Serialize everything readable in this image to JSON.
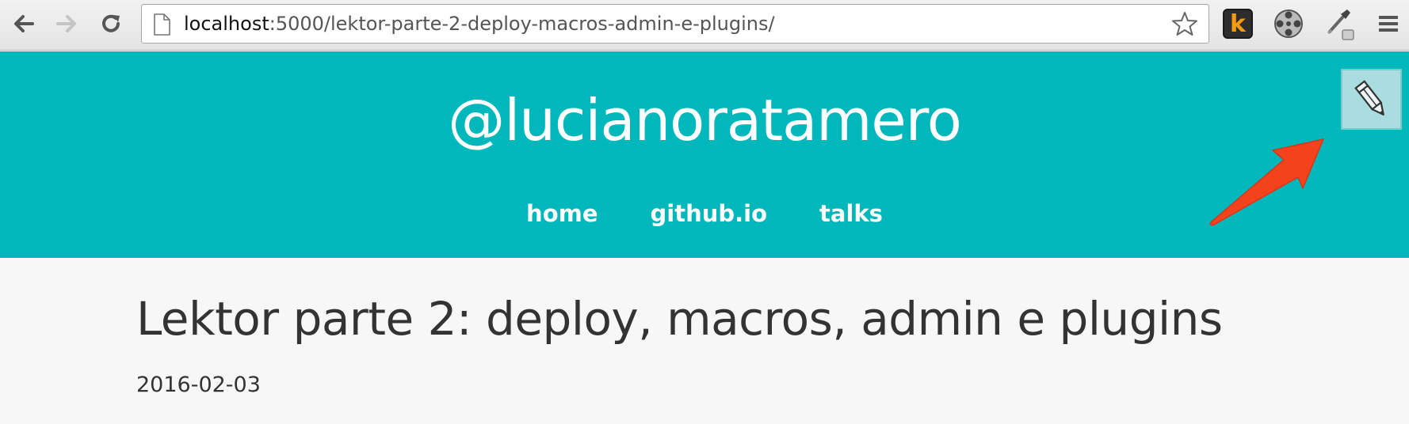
{
  "browser": {
    "url_host": "localhost",
    "url_path": ":5000/lektor-parte-2-deploy-macros-admin-e-plugins/",
    "extension_k_label": "k",
    "icons": [
      "back-icon",
      "forward-icon",
      "reload-icon",
      "page-icon",
      "star-icon",
      "film-reel-icon",
      "eyedropper-icon",
      "menu-icon"
    ]
  },
  "header": {
    "site_title": "@lucianoratamero",
    "nav": [
      {
        "label": "home"
      },
      {
        "label": "github.io"
      },
      {
        "label": "talks"
      }
    ],
    "bg_color": "#00b8bb",
    "edit_icon": "pencil-icon"
  },
  "post": {
    "title": "Lektor parte 2: deploy, macros, admin e plugins",
    "date": "2016-02-03"
  },
  "annotation": {
    "arrow_color": "#f3431d"
  }
}
